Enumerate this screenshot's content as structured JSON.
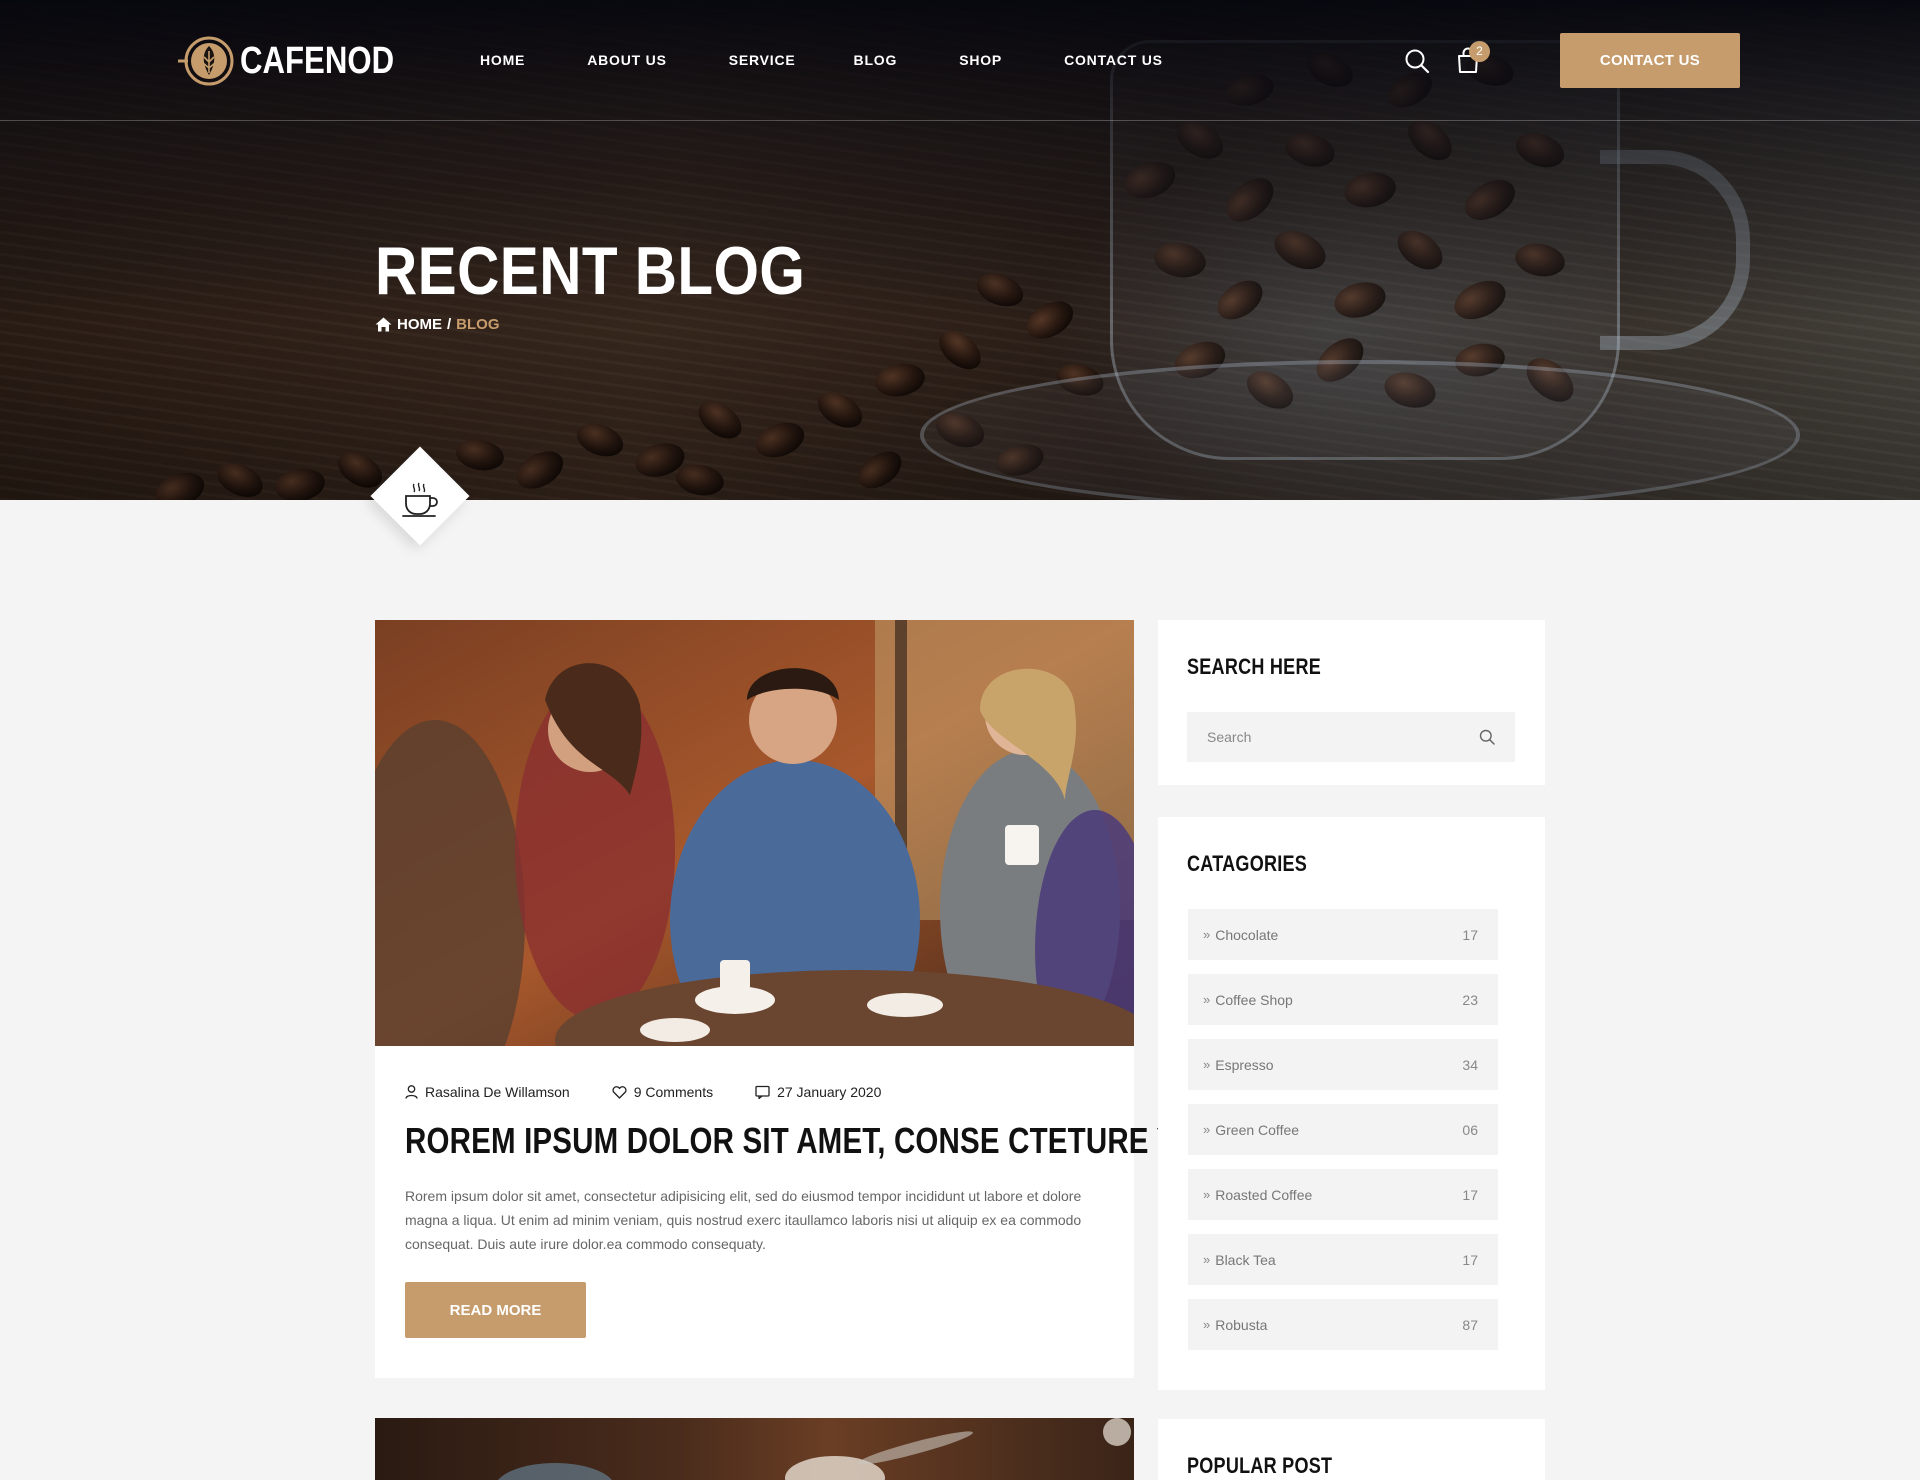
{
  "brand": {
    "name": "CAFENOD"
  },
  "nav": {
    "items": [
      "HOME",
      "ABOUT US",
      "SERVICE",
      "BLOG",
      "SHOP",
      "CONTACT US"
    ],
    "cart_count": "2",
    "contact_button": "CONTACT US"
  },
  "hero": {
    "title": "RECENT BLOG",
    "breadcrumb": {
      "home": "HOME",
      "separator": "/",
      "current": "BLOG"
    }
  },
  "post": {
    "author": "Rasalina De Willamson",
    "comments": "9 Comments",
    "date": "27 January 2020",
    "title": "ROREM IPSUM DOLOR SIT AMET, CONSE CTETURE YEMEI..",
    "excerpt": "Rorem ipsum dolor sit amet, consectetur adipisicing elit, sed do eiusmod tempor incididunt ut labore et dolore magna a liqua. Ut enim ad minim veniam, quis  nostrud exerc itaullamco laboris nisi ut aliquip ex ea commodo consequat. Duis aute irure dolor.ea commodo consequaty.",
    "read_more": "READ MORE"
  },
  "sidebar": {
    "search": {
      "title": "SEARCH HERE",
      "placeholder": "Search"
    },
    "categories": {
      "title": "CATAGORIES",
      "items": [
        {
          "name": "Chocolate",
          "count": "17"
        },
        {
          "name": "Coffee Shop",
          "count": "23"
        },
        {
          "name": "Espresso",
          "count": "34"
        },
        {
          "name": "Green Coffee",
          "count": "06"
        },
        {
          "name": "Roasted Coffee",
          "count": "17"
        },
        {
          "name": "Black Tea",
          "count": "17"
        },
        {
          "name": "Robusta",
          "count": "87"
        }
      ]
    },
    "popular": {
      "title": "POPULAR POST"
    }
  },
  "colors": {
    "accent": "#c69c6d",
    "dark": "#0b0b14",
    "panel": "#f3f3f3"
  }
}
